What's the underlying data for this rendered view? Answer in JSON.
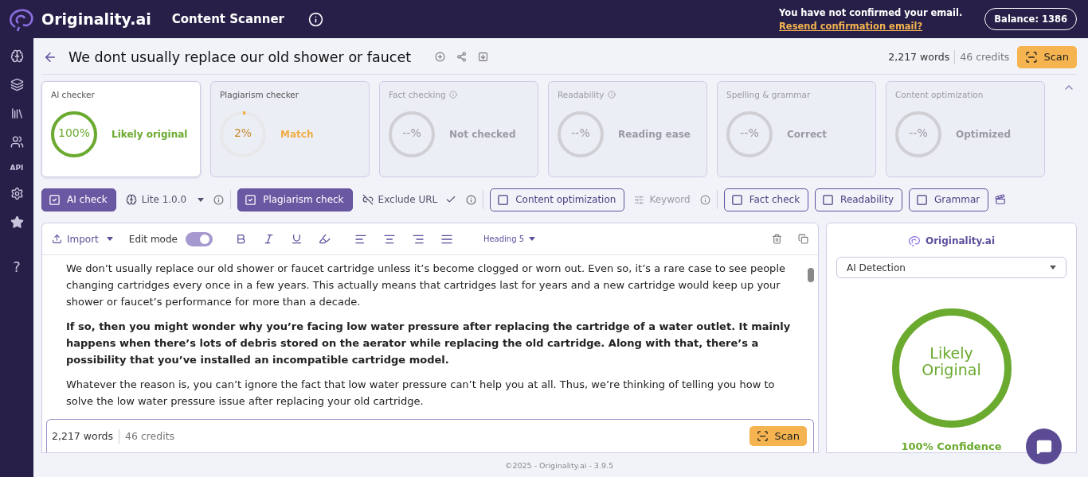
{
  "header": {
    "brand": "Originality.ai",
    "title": "Content Scanner",
    "notice": "You have not confirmed your email.",
    "link": "Resend confirmation email?",
    "balance": "Balance: 1386"
  },
  "sidebar": {
    "api_label": "API",
    "help_label": "?"
  },
  "document": {
    "title": "We dont usually replace our old shower or faucet",
    "words": "2,217 words",
    "credits": "46 credits",
    "scan": "Scan"
  },
  "cards": [
    {
      "title": "AI checker",
      "value": "100%",
      "status": "Likely original",
      "selected": true,
      "disabled": false,
      "info": false,
      "color": "#6aaa2e",
      "level": 1
    },
    {
      "title": "Plagiarism checker",
      "value": "2%",
      "status": "Match",
      "selected": false,
      "disabled": false,
      "info": false,
      "color": "#f0ad45",
      "level": 0.02
    },
    {
      "title": "Fact checking",
      "value": "--%",
      "status": "Not checked",
      "selected": false,
      "disabled": true,
      "info": true
    },
    {
      "title": "Readability",
      "value": "--%",
      "status": "Reading ease",
      "selected": false,
      "disabled": true,
      "info": true
    },
    {
      "title": "Spelling & grammar",
      "value": "--%",
      "status": "Correct",
      "selected": false,
      "disabled": true,
      "info": false
    },
    {
      "title": "Content optimization",
      "value": "--%",
      "status": "Optimized",
      "selected": false,
      "disabled": true,
      "info": false
    }
  ],
  "options": [
    {
      "kind": "checkbox",
      "label": "AI check",
      "checked": true
    },
    {
      "kind": "dropdown",
      "label": "Lite 1.0.0"
    },
    {
      "kind": "checkbox",
      "label": "Plagiarism check",
      "checked": true
    },
    {
      "kind": "exclude",
      "label": "Exclude URL"
    },
    {
      "kind": "checkbox",
      "label": "Content optimization",
      "checked": false
    },
    {
      "kind": "keyword",
      "label": "Keyword",
      "disabled": true
    },
    {
      "kind": "checkbox",
      "label": "Fact check",
      "checked": false
    },
    {
      "kind": "checkbox",
      "label": "Readability",
      "checked": false
    },
    {
      "kind": "checkbox",
      "label": "Grammar",
      "checked": false
    }
  ],
  "editor": {
    "import": "Import",
    "edit_mode": "Edit mode",
    "edit_on": true,
    "heading": "Heading 5",
    "paragraphs": [
      {
        "text": "We don’t usually replace our old shower or faucet cartridge unless it’s become clogged or worn out. Even so, it’s a rare case to see people changing cartridges every once in a few years. This actually means that cartridges last for years and a new cartridge would keep up your shower or faucet’s performance for more than a decade.",
        "bold": false
      },
      {
        "text": "If so, then you might wonder why you’re facing low water pressure after replacing the cartridge of a water outlet. It mainly happens when there’s lots of debris stored on the aerator while replacing the old cartridge. Along with that, there’s a possibility that you’ve installed an incompatible cartridge model.",
        "bold": true
      },
      {
        "text": "Whatever the reason is, you can’t ignore the fact that low water pressure can’t help you at all. Thus, we’re thinking of telling you how to solve the low water pressure issue after replacing your old cartridge.",
        "bold": false
      }
    ],
    "words": "2,217 words",
    "credits": "46 credits",
    "scan": "Scan"
  },
  "result": {
    "brand": "Originality.ai",
    "mode": "AI Detection",
    "verdict": "Likely Original",
    "confidence": "100% Confidence",
    "level": 1
  },
  "footer": "©2025 - Originality.ai - 3.9.5"
}
